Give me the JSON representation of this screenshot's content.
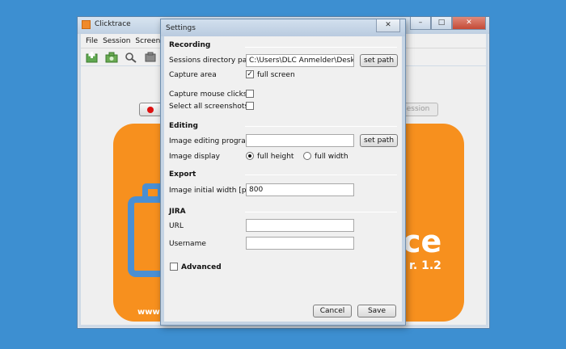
{
  "app": {
    "title": "Clicktrace",
    "menu": [
      "File",
      "Session",
      "Screens"
    ],
    "toolbar_icons": [
      "add-screenshot-icon",
      "camera-icon",
      "zoom-icon",
      "settings-icon"
    ],
    "session_button_label": "Session",
    "banner": {
      "brand_text": "ce",
      "version_text": "r. 1.2",
      "url_text": "www."
    },
    "window_controls": [
      "–",
      "□",
      "✕"
    ]
  },
  "dialog": {
    "title": "Settings",
    "close_glyph": "✕",
    "recording": {
      "title": "Recording",
      "sessions_dir_label": "Sessions directory path",
      "sessions_dir_value": "C:\\Users\\DLC Anmelder\\Desktop\\",
      "set_path_label": "set path",
      "capture_area_label": "Capture area",
      "full_screen_label": "full screen",
      "full_screen_checked": true,
      "capture_mouse_label": "Capture mouse clicks",
      "capture_mouse_checked": false,
      "select_all_label": "Select all screenshots",
      "select_all_checked": false
    },
    "editing": {
      "title": "Editing",
      "program_label": "Image editing program",
      "program_value": "",
      "set_path_label": "set path",
      "display_label": "Image display",
      "full_height_label": "full height",
      "full_width_label": "full width",
      "selected": "full height"
    },
    "export": {
      "title": "Export",
      "width_label": "Image initial width [px]",
      "width_value": "800"
    },
    "jira": {
      "title": "JIRA",
      "url_label": "URL",
      "url_value": "",
      "username_label": "Username",
      "username_value": ""
    },
    "advanced": {
      "label": "Advanced",
      "checked": false
    },
    "cancel_label": "Cancel",
    "save_label": "Save"
  }
}
